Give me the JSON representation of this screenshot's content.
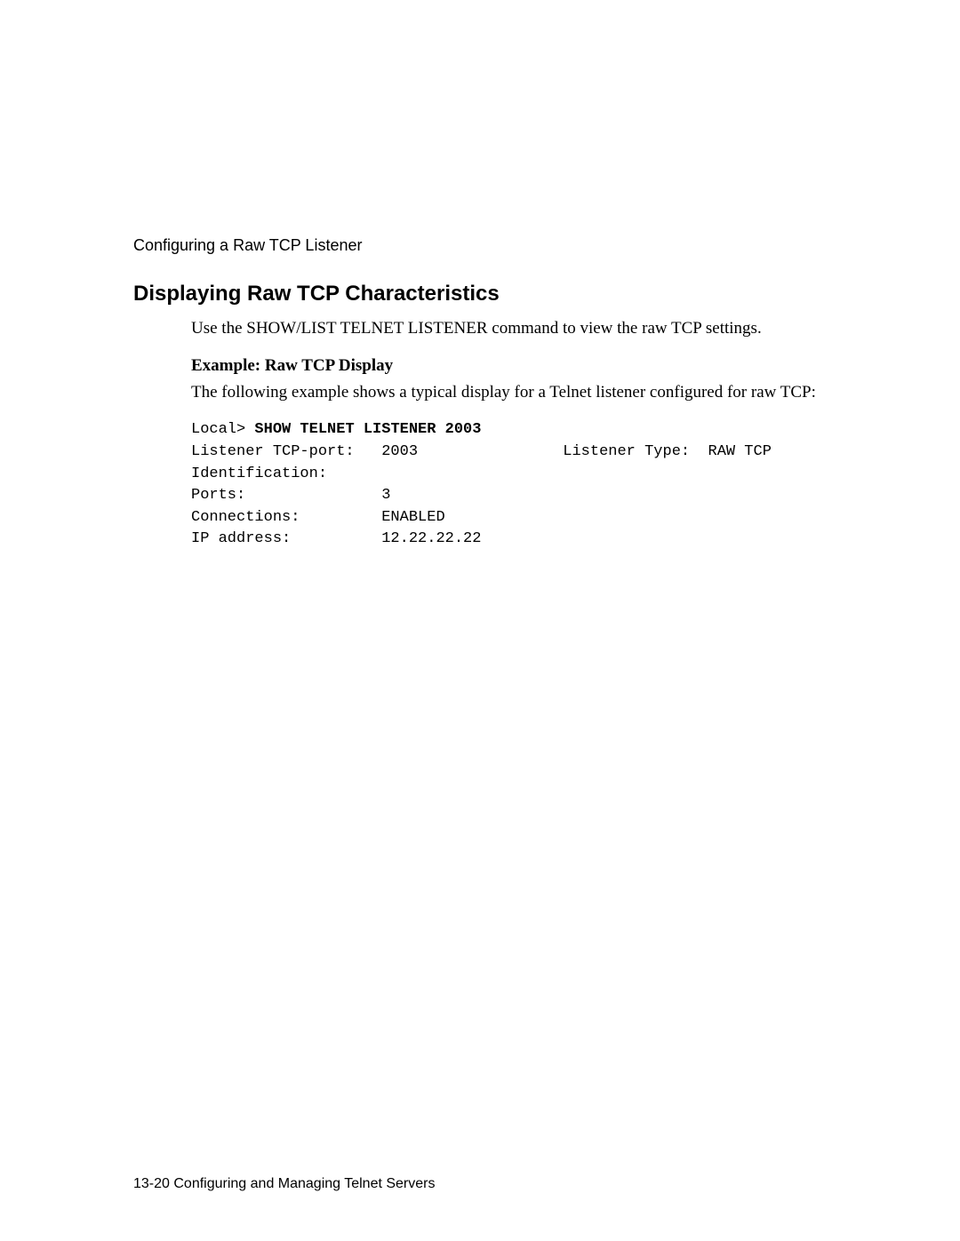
{
  "section_label": "Configuring a Raw TCP Listener",
  "heading": "Displaying Raw TCP Characteristics",
  "intro": "Use the SHOW/LIST TELNET LISTENER command to view the raw TCP settings.",
  "subheading": "Example: Raw TCP Display",
  "example_desc": "The following example shows a typical display for a Telnet listener configured for raw TCP:",
  "code": {
    "prompt": "Local> ",
    "command": "SHOW TELNET LISTENER 2003",
    "output_line1": "Listener TCP-port:   2003                Listener Type:  RAW TCP",
    "output_line2": "Identification:",
    "output_line3": "Ports:               3",
    "output_line4": "Connections:         ENABLED",
    "output_line5": "IP address:          12.22.22.22"
  },
  "footer": "13-20  Configuring and Managing Telnet Servers"
}
